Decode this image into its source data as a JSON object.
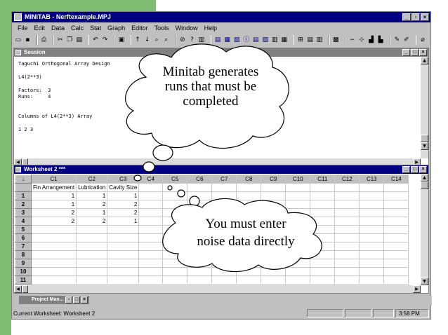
{
  "app": {
    "title": "MINITAB - Nerftexample.MPJ",
    "menu": [
      "File",
      "Edit",
      "Data",
      "Calc",
      "Stat",
      "Graph",
      "Editor",
      "Tools",
      "Window",
      "Help"
    ]
  },
  "session": {
    "title": "Session",
    "lines": [
      "Taguchi Orthogonal Array Design",
      "",
      "L4(2**3)",
      "",
      "Factors:  3",
      "Runs:     4",
      "",
      "",
      "Columns of L4(2**3) Array",
      "",
      "1 2 3"
    ]
  },
  "worksheet": {
    "title": "Worksheet 2 ***",
    "corner": "↓",
    "columns": [
      "C1",
      "C2",
      "C3",
      "C4",
      "C5",
      "C6",
      "C7",
      "C8",
      "C9",
      "C10",
      "C11",
      "C12",
      "C13",
      "C14"
    ],
    "names": [
      "Fin Arrangement",
      "Lubrication",
      "Cavity Size"
    ],
    "rows": [
      {
        "id": "1",
        "values": [
          "1",
          "1",
          "1"
        ]
      },
      {
        "id": "2",
        "values": [
          "1",
          "2",
          "2"
        ]
      },
      {
        "id": "3",
        "values": [
          "2",
          "1",
          "2"
        ]
      },
      {
        "id": "4",
        "values": [
          "2",
          "2",
          "1"
        ]
      },
      {
        "id": "5",
        "values": []
      },
      {
        "id": "6",
        "values": []
      },
      {
        "id": "7",
        "values": []
      },
      {
        "id": "8",
        "values": []
      },
      {
        "id": "9",
        "values": []
      },
      {
        "id": "10",
        "values": []
      },
      {
        "id": "11",
        "values": []
      }
    ]
  },
  "project_manager": {
    "title": "Project Man..."
  },
  "status": {
    "text": "Current Worksheet: Worksheet 2",
    "time": "3:58 PM"
  },
  "callouts": {
    "top": "Minitab generates runs that must be completed",
    "top_lines": [
      "Minitab generates",
      "runs that must be",
      "completed"
    ],
    "bottom": "You must enter noise data directly",
    "bottom_lines": [
      "You must enter",
      "noise data directly"
    ]
  },
  "colors": {
    "title_active": "#000080",
    "title_inactive": "#808080",
    "chrome": "#c0c0c0",
    "slide_accent": "#7fbe72"
  }
}
